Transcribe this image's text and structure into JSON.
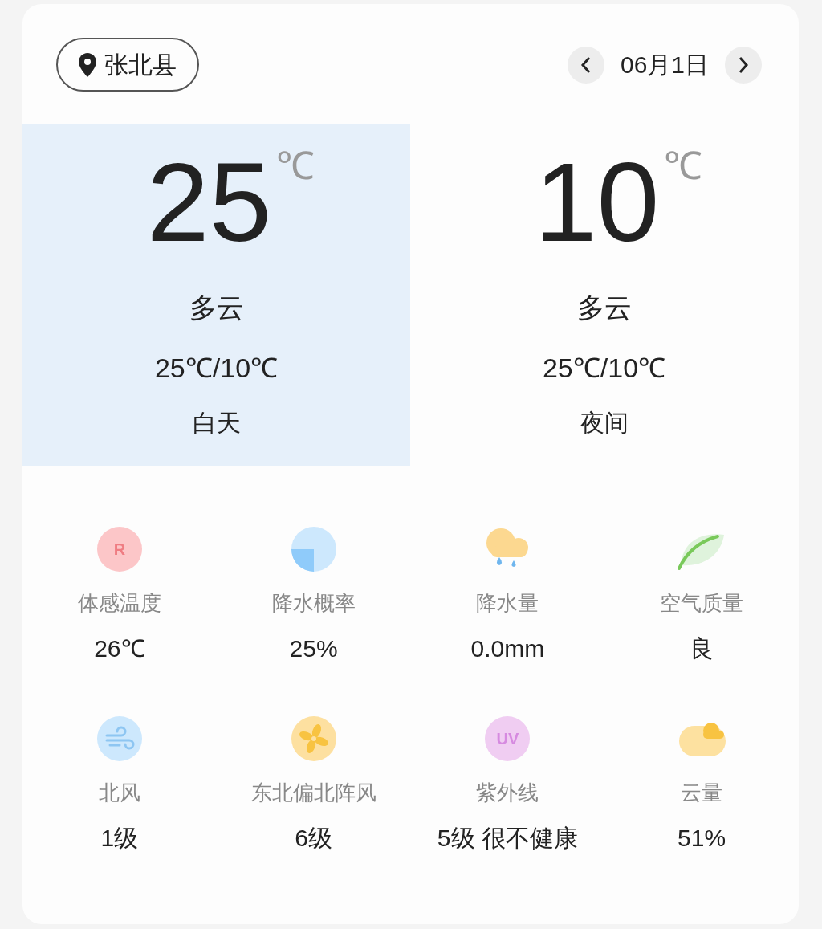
{
  "location": "张北县",
  "date": "06月1日",
  "periods": [
    {
      "temp": "25",
      "unit": "℃",
      "condition": "多云",
      "range": "25℃/10℃",
      "label": "白天",
      "selected": true
    },
    {
      "temp": "10",
      "unit": "℃",
      "condition": "多云",
      "range": "25℃/10℃",
      "label": "夜间",
      "selected": false
    }
  ],
  "details": [
    {
      "kind": "feels",
      "icon_text": "R",
      "label": "体感温度",
      "value": "26℃"
    },
    {
      "kind": "rain_chance",
      "label": "降水概率",
      "value": "25%"
    },
    {
      "kind": "rain",
      "label": "降水量",
      "value": "0.0mm"
    },
    {
      "kind": "air",
      "label": "空气质量",
      "value": "良"
    },
    {
      "kind": "wind",
      "label": "北风",
      "value": "1级"
    },
    {
      "kind": "gust",
      "label": "东北偏北阵风",
      "value": "6级"
    },
    {
      "kind": "uv",
      "icon_text": "UV",
      "label": "紫外线",
      "value": "5级 很不健康"
    },
    {
      "kind": "cloud",
      "label": "云量",
      "value": "51%"
    }
  ]
}
